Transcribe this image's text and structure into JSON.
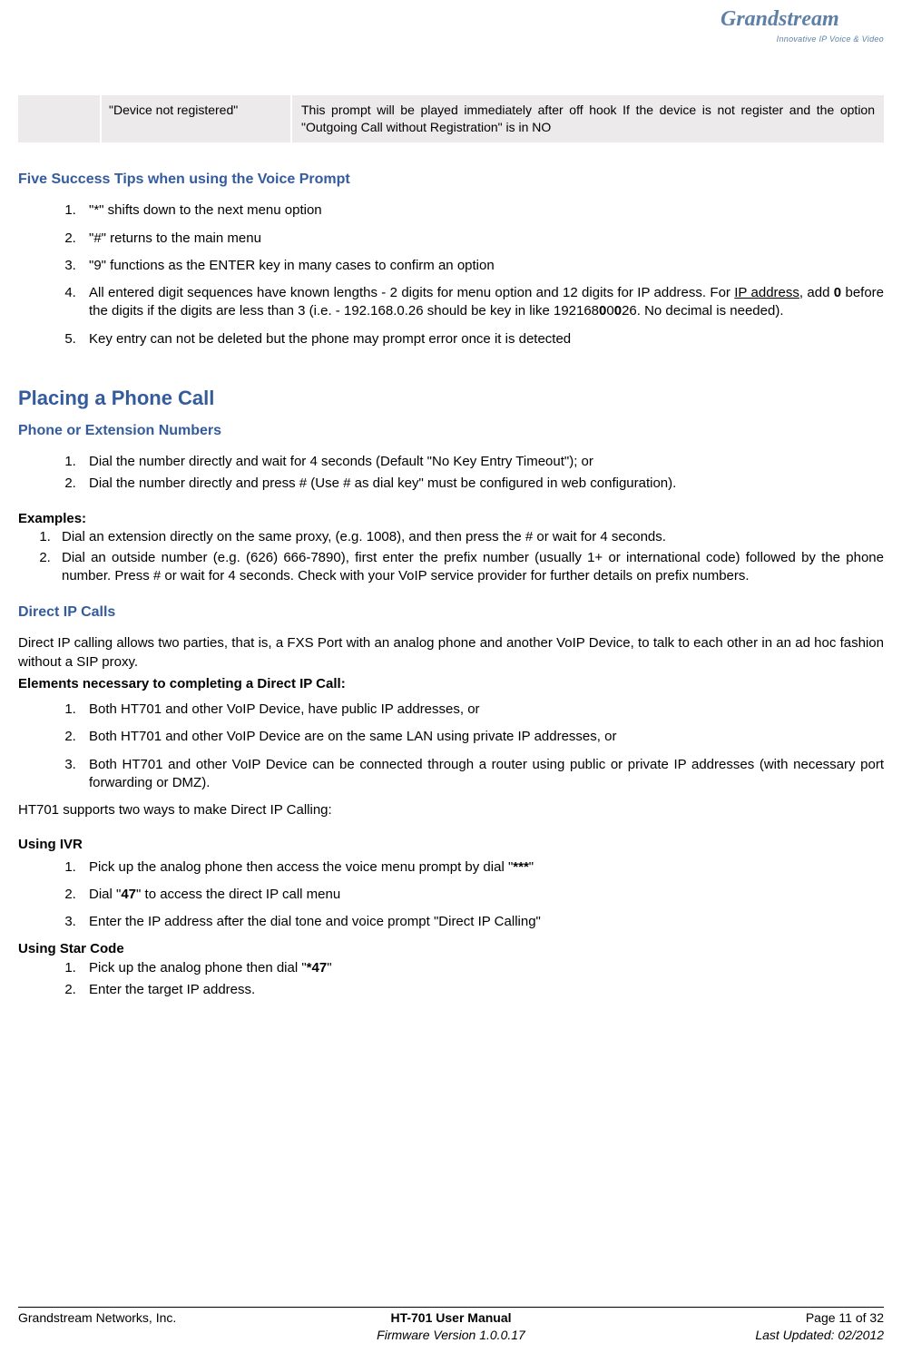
{
  "logo": {
    "brand": "Grandstream",
    "tagline": "Innovative IP Voice & Video"
  },
  "table": {
    "col2": "\"Device not registered\"",
    "col3": "This prompt will be played immediately after off hook If the device is not register and the option \"Outgoing Call without Registration\" is in NO"
  },
  "tips": {
    "heading": "Five Success Tips when using the Voice Prompt",
    "items": [
      "\"*\" shifts down to the next menu option",
      "\"#\" returns to the main menu",
      "\"9\" functions as the ENTER key in many cases to confirm an option",
      "",
      "Key entry can not be deleted but the phone may prompt error once it is detected"
    ],
    "item4_pre": "All entered digit sequences have known lengths - 2 digits for menu option and 12 digits for IP address. For ",
    "item4_u": "IP address",
    "item4_mid1": ", add ",
    "item4_b1": "0",
    "item4_mid2": " before the digits if the digits are less than 3 (i.e. - 192.168.0.26 should be key in like 192168",
    "item4_b2": "0",
    "item4_mid3": "0",
    "item4_b3": "0",
    "item4_mid4": "0",
    "item4_b4": "0",
    "item4_end": "26.  No decimal is needed)."
  },
  "placing": {
    "heading": "Placing a Phone Call",
    "sub1": "Phone or Extension Numbers",
    "list1": [
      "Dial the number directly and wait for 4 seconds (Default \"No Key Entry Timeout\");  or",
      "Dial the number directly and press # (Use # as dial key\" must be configured in web configuration)."
    ],
    "examples_heading": "Examples:",
    "examples": [
      "Dial an extension directly on the same proxy, (e.g. 1008), and then press the # or wait for 4 seconds.",
      "Dial an outside number (e.g. (626) 666-7890), first enter the prefix number (usually 1+ or international code) followed by the phone number.  Press # or wait for 4 seconds.  Check with your VoIP service provider for further details on prefix numbers."
    ]
  },
  "direct": {
    "heading": "Direct IP Calls",
    "intro": "Direct IP calling allows two parties, that is, a FXS Port with an analog phone and another VoIP Device, to talk to each other in an ad hoc fashion without a SIP proxy.",
    "elements_heading": "Elements necessary to completing a Direct IP Call:",
    "elements": [
      "Both HT701 and other VoIP Device, have public IP addresses, or",
      "Both HT701 and other VoIP Device are on the same LAN using private IP addresses, or",
      "Both HT701 and other VoIP Device can be connected through a router using public or private IP addresses (with necessary port forwarding or DMZ)."
    ],
    "supports": "HT701 supports two ways to make Direct IP Calling:",
    "ivr_heading": "Using IVR",
    "ivr": {
      "i1a": "Pick up the analog phone then access the voice menu prompt by dial \"",
      "i1b": "***",
      "i1c": "\"",
      "i2a": "Dial \"",
      "i2b": "47",
      "i2c": "\" to access the direct IP call menu",
      "i3": "Enter the IP address after the dial tone and voice prompt \"Direct IP Calling\""
    },
    "star_heading": "Using Star Code",
    "star": {
      "i1a": "Pick up the analog phone then dial \"",
      "i1b": "*47",
      "i1c": "\"",
      "i2": "Enter the target IP address."
    }
  },
  "footer": {
    "left": "Grandstream Networks, Inc.",
    "center1": "HT-701 User Manual",
    "center2": "Firmware Version 1.0.0.17",
    "right1": "Page 11 of 32",
    "right2": "Last Updated: 02/2012"
  }
}
